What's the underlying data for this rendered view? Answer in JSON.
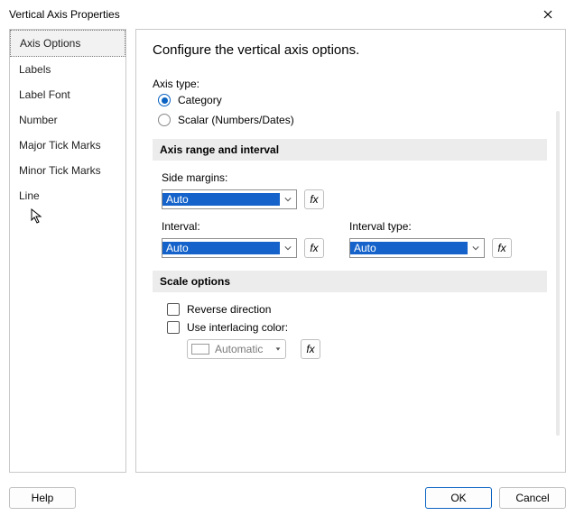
{
  "title": "Vertical Axis Properties",
  "sidebar": {
    "items": [
      {
        "label": "Axis Options"
      },
      {
        "label": "Labels"
      },
      {
        "label": "Label Font"
      },
      {
        "label": "Number"
      },
      {
        "label": "Major Tick Marks"
      },
      {
        "label": "Minor Tick Marks"
      },
      {
        "label": "Line"
      }
    ]
  },
  "main": {
    "heading": "Configure the vertical axis options.",
    "axis_type_label": "Axis type:",
    "axis_type": {
      "category": "Category",
      "scalar": "Scalar (Numbers/Dates)"
    },
    "section_range": "Axis range and interval",
    "side_margins_label": "Side margins:",
    "side_margins_value": "Auto",
    "interval_label": "Interval:",
    "interval_value": "Auto",
    "interval_type_label": "Interval type:",
    "interval_type_value": "Auto",
    "fx_label": "fx",
    "section_scale": "Scale options",
    "reverse_label": "Reverse direction",
    "interlace_label": "Use interlacing color:",
    "color_label": "Automatic"
  },
  "footer": {
    "help": "Help",
    "ok": "OK",
    "cancel": "Cancel"
  }
}
